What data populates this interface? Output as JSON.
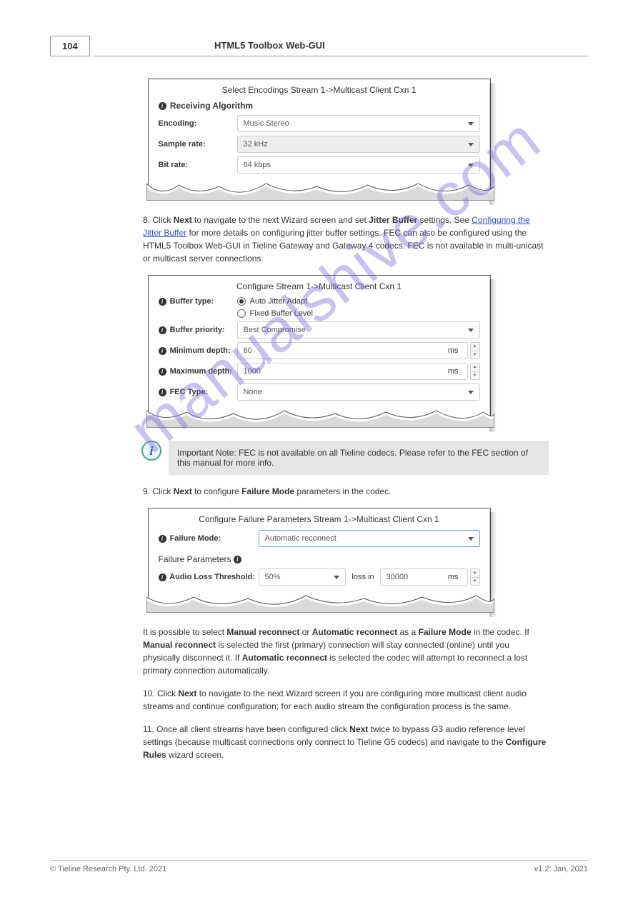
{
  "page_number": "104",
  "header_title": "HTML5 Toolbox Web-GUI",
  "panel1": {
    "title": "Select Encodings Stream 1->Multicast Client Cxn 1",
    "section": "Receiving Algorithm",
    "encoding_label": "Encoding:",
    "encoding_value": "Music Stereo",
    "sample_label": "Sample rate:",
    "sample_value": "32 kHz",
    "bit_label": "Bit rate:",
    "bit_value": "64 kbps"
  },
  "para1": {
    "pre": "Click ",
    "bold": "Next",
    "post": " to navigate to the next Wizard screen and set ",
    "bold2": "Jitter Buffer",
    "post2": " settings. See ",
    "link": "Configuring the Jitter Buffer",
    "post3": " for more details on configuring jitter buffer settings. FEC can also be configured using the HTML5 Toolbox Web-GUI in Tieline Gateway and Gateway 4 codecs. FEC is not available in multi-unicast or multicast server connections."
  },
  "panel2": {
    "title": "Configure Stream 1->Multicast Client Cxn 1",
    "buffer_type_label": "Buffer type:",
    "radio1": "Auto Jitter Adapt",
    "radio2": "Fixed Buffer Level",
    "buffer_priority_label": "Buffer priority:",
    "buffer_priority_value": "Best Compromise",
    "min_depth_label": "Minimum depth:",
    "min_depth_value": "60",
    "max_depth_label": "Maximum depth:",
    "max_depth_value": "1000",
    "fec_label": "FEC Type:",
    "fec_value": "None",
    "ms": "ms"
  },
  "note": {
    "text": "Important Note: FEC is not available on all Tieline codecs. Please refer to the FEC section of this manual for more info."
  },
  "para2": {
    "pre": "Click ",
    "bold": "Next",
    "post": " to configure ",
    "bold2": "Failure Mode",
    "post2": " parameters in the codec."
  },
  "panel3": {
    "title": "Configure Failure Parameters Stream 1->Multicast Client Cxn 1",
    "failure_mode_label": "Failure Mode:",
    "failure_mode_value": "Automatic reconnect",
    "section": "Failure Parameters",
    "audio_loss_label": "Audio Loss Threshold:",
    "audio_loss_pct": "50%",
    "loss_in": "loss in",
    "audio_loss_ms": "30000",
    "ms": "ms"
  },
  "para3": {
    "pre1": "It is possible to select ",
    "b1": "Manual reconnect",
    "mid1": " or ",
    "b2": "Automatic reconnect",
    "mid2": " as a ",
    "b3": "Failure Mode",
    "post1": " in the codec. If ",
    "b4": "Manual reconnect",
    "post2": " is selected the first (primary) connection will stay connected (online) until you physically disconnect it. If ",
    "b5": "Automatic reconnect",
    "post3": " is selected the codec will attempt to reconnect a lost primary connection automatically."
  },
  "para4": {
    "pre": "Click ",
    "bold": "Next",
    "post": " to navigate to the next Wizard screen if you are configuring more multicast client audio streams and continue configuration; for each audio stream the configuration process is the same."
  },
  "para5": {
    "pre": "Once all client streams have been configured click ",
    "bold": "Next",
    "post": " twice to bypass G3 audio reference level settings (because multicast connections only connect to Tieline G5 codecs) and navigate to the ",
    "bold2": "Configure Rules",
    "post2": " wizard screen."
  },
  "watermark": "manualshive.com",
  "footer_left": "© Tieline Research Pty. Ltd. 2021",
  "footer_right": "v1.2: Jan, 2021"
}
